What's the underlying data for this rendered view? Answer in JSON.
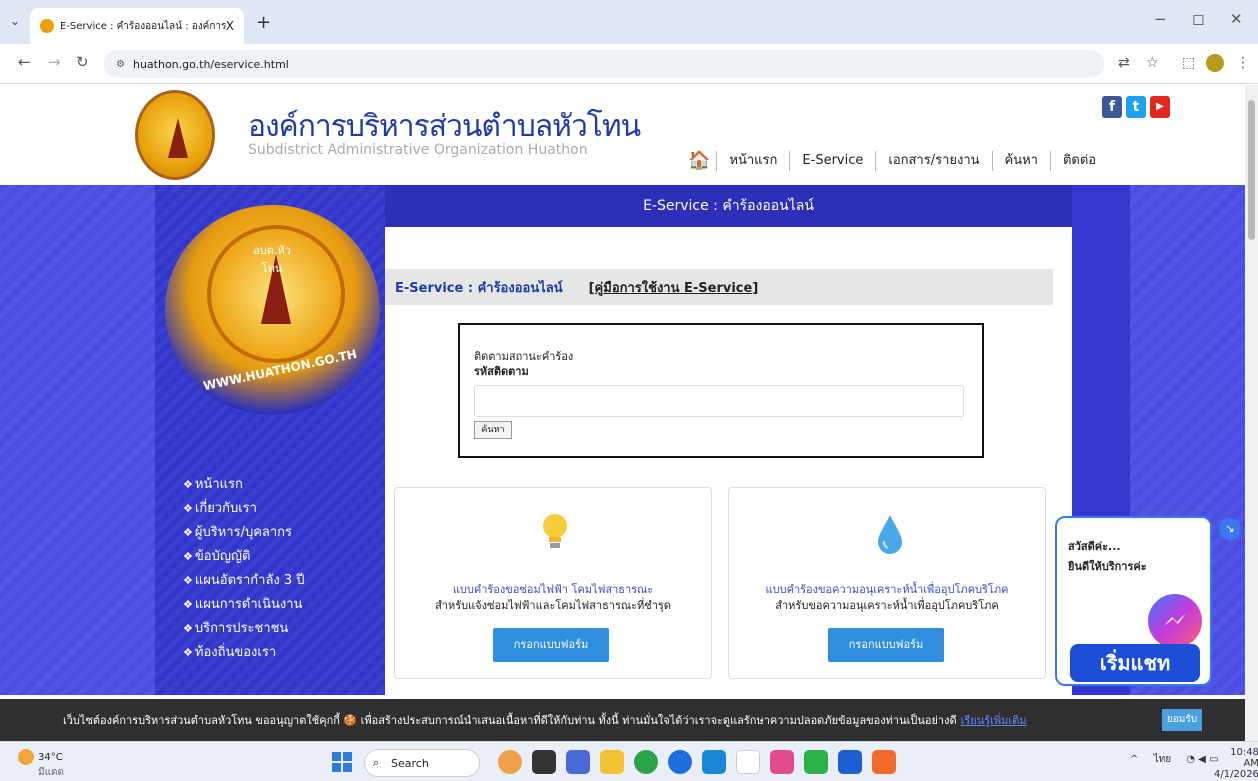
{
  "browser": {
    "tab_title": "E-Service : คำร้องออนไลน์ : องค์การ",
    "close_label": "X",
    "new_tab_label": "+",
    "url": "huathon.go.th/eservice.html",
    "minimize": "−",
    "restore": "◻",
    "close": "✕"
  },
  "header": {
    "org_name": "องค์การบริหารส่วนตำบลหัวโทน",
    "org_sub": "Subdistrict Administrative Organization Huathon",
    "nav": [
      "หน้าแรก",
      "E-Service",
      "เอกสาร/รายงาน",
      "ค้นหา",
      "ติดต่อ"
    ],
    "social": {
      "facebook": "f",
      "twitter": "t",
      "youtube": "▶"
    }
  },
  "page": {
    "title_bar": "E-Service : คำร้องออนไลน์",
    "emblem_top": "อบต.หัวโทน",
    "emblem_watermark": "WWW.HUATHON.GO.TH",
    "sidebar": [
      "หน้าแรก",
      "เกี่ยวกับเรา",
      "ผู้บริหาร/บุคลากร",
      "ข้อบัญญัติ",
      "แผนอัตรากำลัง 3 ปี",
      "แผนการดำเนินงาน",
      "บริการประชาชน",
      "ท้องถิ่นของเรา"
    ],
    "content_header": "E-Service : คำร้องออนไลน์",
    "manual_link": "[คู่มือการใช้งาน E-Service]",
    "track": {
      "label": "ติดตามสถานะคำร้อง",
      "code_label": "รหัสติดตาม",
      "input_value": "",
      "button": "ค้นหา"
    },
    "cards": [
      {
        "title": "แบบคำร้องขอซ่อมไฟฟ้า โคมไฟสาธารณะ",
        "subtitle": "สำหรับแจ้งซ่อมไฟฟ้าและโคมไฟสาธารณะที่ชำรุด",
        "button": "กรอกแบบฟอร์ม"
      },
      {
        "title": "แบบคำร้องขอความอนุเคราะห์น้ำเพื่ออุปโภคบริโภค",
        "subtitle": "สำหรับขอความอนุเคราะห์น้ำเพื่ออุปโภคบริโภค",
        "button": "กรอกแบบฟอร์ม"
      }
    ]
  },
  "chat": {
    "line1": "สวัสดีค่ะ...",
    "line2": "ยินดีให้บริการค่ะ",
    "button": "เริ่มแชท"
  },
  "cookie": {
    "text": "เว็บไซต์องค์การบริหารส่วนตำบลหัวโทน ขออนุญาตใช้คุกกี้ 🍪 เพื่อสร้างประสบการณ์นำเสนอเนื้อหาที่ดีให้กับท่าน ทั้งนี้ ท่านมั่นใจได้ว่าเราจะดูแลรักษาความปลอดภัยข้อมูลของท่านเป็นอย่างดี",
    "link": "เรียนรู้เพิ่มเติม",
    "accept": "ยอมรับ"
  },
  "taskbar": {
    "weather_temp": "34°C",
    "weather_desc": "มีแดด",
    "search_placeholder": "Search",
    "lang": "ไทย",
    "time": "10:48 AM",
    "date": "4/1/2026"
  },
  "colors": {
    "accent": "#2c30b8",
    "band": "#4a4ee0",
    "button": "#2f8ee0"
  }
}
